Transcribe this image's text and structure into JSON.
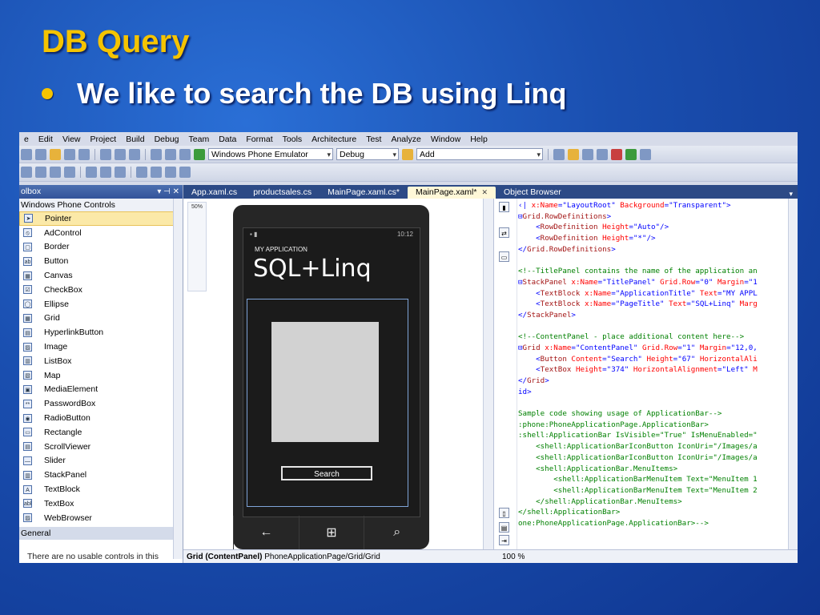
{
  "slide": {
    "title": "DB Query",
    "bullet": "We like to search the DB using Linq"
  },
  "menu": [
    "e",
    "Edit",
    "View",
    "Project",
    "Build",
    "Debug",
    "Team",
    "Data",
    "Format",
    "Tools",
    "Architecture",
    "Test",
    "Analyze",
    "Window",
    "Help"
  ],
  "toolbar": {
    "target_combo": "Windows Phone Emulator",
    "config_combo": "Debug",
    "find_combo": "Add"
  },
  "toolbox": {
    "title": "olbox",
    "header_controls": "▾ ⊣ ✕",
    "group": "Windows Phone Controls",
    "items": [
      "Pointer",
      "AdControl",
      "Border",
      "Button",
      "Canvas",
      "CheckBox",
      "Ellipse",
      "Grid",
      "HyperlinkButton",
      "Image",
      "ListBox",
      "Map",
      "MediaElement",
      "PasswordBox",
      "RadioButton",
      "Rectangle",
      "ScrollViewer",
      "Slider",
      "StackPanel",
      "TextBlock",
      "TextBox",
      "WebBrowser"
    ],
    "general_group": "General",
    "footer": "There are no usable controls in this"
  },
  "tabs": [
    "App.xaml.cs",
    "productsales.cs",
    "MainPage.xaml.cs*",
    "MainPage.xaml*",
    "Object Browser"
  ],
  "design": {
    "zoom_label": "50%",
    "status_time": "10:12",
    "app_title": "MY APPLICATION",
    "page_title": "SQL+Linq",
    "button_label": "Search"
  },
  "xaml_lines": [
    [
      [
        "vl",
        "‹|"
      ],
      [
        "at",
        " x:Name"
      ],
      [
        "vl",
        "=\"LayoutRoot\""
      ],
      [
        "at",
        " Background"
      ],
      [
        "vl",
        "=\"Transparent\">"
      ]
    ],
    [
      [
        "pn",
        "⊟"
      ],
      [
        "kw",
        "Grid.RowDefinitions"
      ],
      [
        "pn",
        ">"
      ]
    ],
    [
      [
        "pn",
        "    <"
      ],
      [
        "kw",
        "RowDefinition"
      ],
      [
        "at",
        " Height"
      ],
      [
        "vl",
        "=\"Auto\"/>"
      ]
    ],
    [
      [
        "pn",
        "    <"
      ],
      [
        "kw",
        "RowDefinition"
      ],
      [
        "at",
        " Height"
      ],
      [
        "vl",
        "=\"*\"/>"
      ]
    ],
    [
      [
        "pn",
        "</"
      ],
      [
        "kw",
        "Grid.RowDefinitions"
      ],
      [
        "pn",
        ">"
      ]
    ],
    [
      [
        "pn",
        ""
      ]
    ],
    [
      [
        "cm",
        "<!--TitlePanel contains the name of the application an"
      ]
    ],
    [
      [
        "pn",
        "⊟"
      ],
      [
        "kw",
        "StackPanel"
      ],
      [
        "at",
        " x:Name"
      ],
      [
        "vl",
        "=\"TitlePanel\""
      ],
      [
        "at",
        " Grid.Row"
      ],
      [
        "vl",
        "=\"0\""
      ],
      [
        "at",
        " Margin"
      ],
      [
        "vl",
        "=\"1"
      ]
    ],
    [
      [
        "pn",
        "    <"
      ],
      [
        "kw",
        "TextBlock"
      ],
      [
        "at",
        " x:Name"
      ],
      [
        "vl",
        "=\"ApplicationTitle\""
      ],
      [
        "at",
        " Text"
      ],
      [
        "vl",
        "=\"MY APPL"
      ]
    ],
    [
      [
        "pn",
        "    <"
      ],
      [
        "kw",
        "TextBlock"
      ],
      [
        "at",
        " x:Name"
      ],
      [
        "vl",
        "=\"PageTitle\""
      ],
      [
        "at",
        " Text"
      ],
      [
        "vl",
        "=\"SQL+Linq\""
      ],
      [
        "at",
        " Marg"
      ]
    ],
    [
      [
        "pn",
        "</"
      ],
      [
        "kw",
        "StackPanel"
      ],
      [
        "pn",
        ">"
      ]
    ],
    [
      [
        "pn",
        ""
      ]
    ],
    [
      [
        "cm",
        "<!--ContentPanel - place additional content here-->"
      ]
    ],
    [
      [
        "pn",
        "⊟"
      ],
      [
        "kw",
        "Grid"
      ],
      [
        "at",
        " x:Name"
      ],
      [
        "vl",
        "=\"ContentPanel\""
      ],
      [
        "at",
        " Grid.Row"
      ],
      [
        "vl",
        "=\"1\""
      ],
      [
        "at",
        " Margin"
      ],
      [
        "vl",
        "=\"12,0,"
      ]
    ],
    [
      [
        "pn",
        "    <"
      ],
      [
        "kw",
        "Button"
      ],
      [
        "at",
        " Content"
      ],
      [
        "vl",
        "=\"Search\""
      ],
      [
        "at",
        " Height"
      ],
      [
        "vl",
        "=\"67\""
      ],
      [
        "at",
        " HorizontalAli"
      ]
    ],
    [
      [
        "pn",
        "    <"
      ],
      [
        "kw",
        "TextBox"
      ],
      [
        "at",
        " Height"
      ],
      [
        "vl",
        "=\"374\""
      ],
      [
        "at",
        " HorizontalAlignment"
      ],
      [
        "vl",
        "=\"Left\""
      ],
      [
        "at",
        " M"
      ]
    ],
    [
      [
        "pn",
        "</"
      ],
      [
        "kw",
        "Grid"
      ],
      [
        "pn",
        ">"
      ]
    ],
    [
      [
        "pn",
        "id>"
      ]
    ],
    [
      [
        "pn",
        ""
      ]
    ],
    [
      [
        "cm",
        "Sample code showing usage of ApplicationBar-->"
      ]
    ],
    [
      [
        "cm",
        ":phone:PhoneApplicationPage.ApplicationBar>"
      ]
    ],
    [
      [
        "cm",
        ":shell:ApplicationBar IsVisible=\"True\" IsMenuEnabled=\""
      ]
    ],
    [
      [
        "cm",
        "    <shell:ApplicationBarIconButton IconUri=\"/Images/a"
      ]
    ],
    [
      [
        "cm",
        "    <shell:ApplicationBarIconButton IconUri=\"/Images/a"
      ]
    ],
    [
      [
        "cm",
        "    <shell:ApplicationBar.MenuItems>"
      ]
    ],
    [
      [
        "cm",
        "        <shell:ApplicationBarMenuItem Text=\"MenuItem 1"
      ]
    ],
    [
      [
        "cm",
        "        <shell:ApplicationBarMenuItem Text=\"MenuItem 2"
      ]
    ],
    [
      [
        "cm",
        "    </shell:ApplicationBar.MenuItems>"
      ]
    ],
    [
      [
        "cm",
        "</shell:ApplicationBar>"
      ]
    ],
    [
      [
        "cm",
        "one:PhoneApplicationPage.ApplicationBar>-->"
      ]
    ]
  ],
  "status": {
    "breadcrumb_bold": "Grid (ContentPanel)",
    "breadcrumb_rest": " PhoneApplicationPage/Grid/Grid",
    "zoom": "100 %"
  }
}
